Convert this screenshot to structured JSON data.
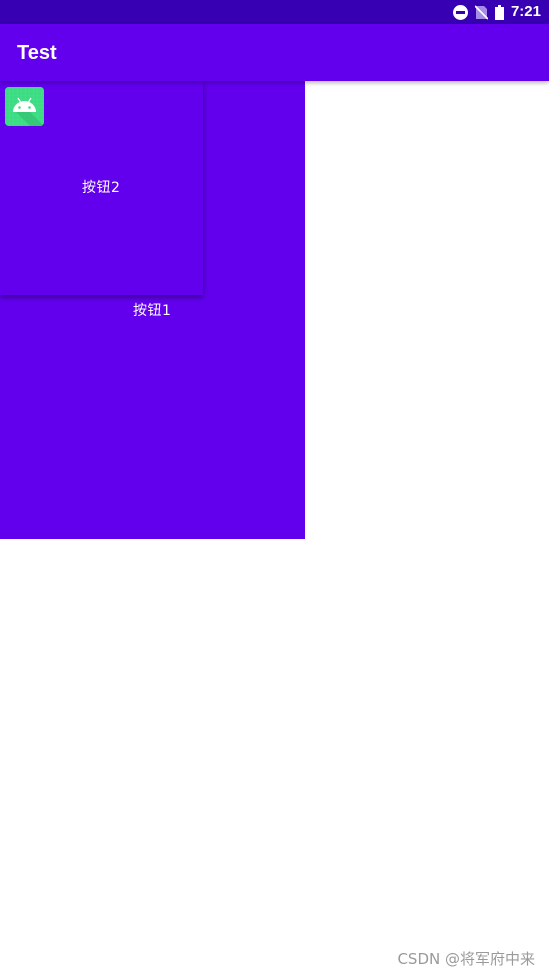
{
  "status_bar": {
    "time": "7:21",
    "icons": [
      "do-not-disturb-icon",
      "no-sim-icon",
      "battery-icon"
    ],
    "background": "#3700b3"
  },
  "app_bar": {
    "title": "Test",
    "background": "#6200ee"
  },
  "content": {
    "button1_label": "按钮1",
    "button2_label": "按钮2",
    "button2_icon": "android-app-icon",
    "button_color": "#6200ee",
    "icon_color": "#3ddc84"
  },
  "watermark": {
    "text": "CSDN @将军府中来"
  }
}
